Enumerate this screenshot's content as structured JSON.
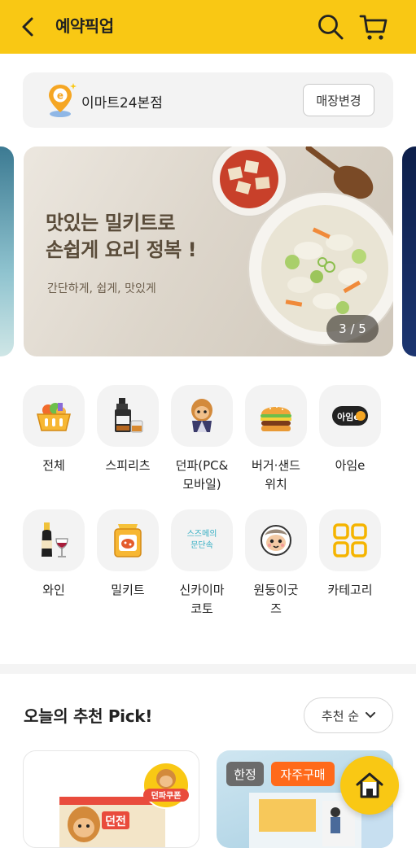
{
  "header": {
    "title": "예약픽업"
  },
  "store": {
    "name": "이마트24본점",
    "change_label": "매장변경"
  },
  "banner": {
    "title": "맛있는 밀키트로\n손쉽게 요리 정복 !",
    "subtitle": "간단하게, 쉽게, 맛있게",
    "pager": "3 / 5"
  },
  "categories": [
    {
      "label": "전체",
      "icon": "basket-icon"
    },
    {
      "label": "스피리츠",
      "icon": "whiskey-icon"
    },
    {
      "label": "던파(PC&\n모바일)",
      "icon": "character-icon"
    },
    {
      "label": "버거·샌드\n위치",
      "icon": "burger-icon"
    },
    {
      "label": "아임e",
      "icon": "ime-logo-icon"
    },
    {
      "label": "와인",
      "icon": "wine-icon"
    },
    {
      "label": "밀키트",
      "icon": "mealkit-icon"
    },
    {
      "label": "신카이마\n코토",
      "icon": "shinkai-icon"
    },
    {
      "label": "원둥이굿\n즈",
      "icon": "monkey-icon"
    },
    {
      "label": "카테고리",
      "icon": "grid-icon"
    }
  ],
  "category_icon_texts": {
    "ime": "아임e",
    "shinkai": "스즈메의\n문단속"
  },
  "pick": {
    "title": "오늘의 추천 Pick!",
    "sort_label": "추천 순"
  },
  "products": [
    {
      "badge_text": "던파쿠폰",
      "label_text": "던전"
    },
    {
      "badges": [
        "한정",
        "자주구매"
      ]
    }
  ],
  "colors": {
    "brand_yellow": "#f9c814",
    "badge_orange": "#ff6a1a",
    "badge_gray": "#6b6b6b"
  }
}
